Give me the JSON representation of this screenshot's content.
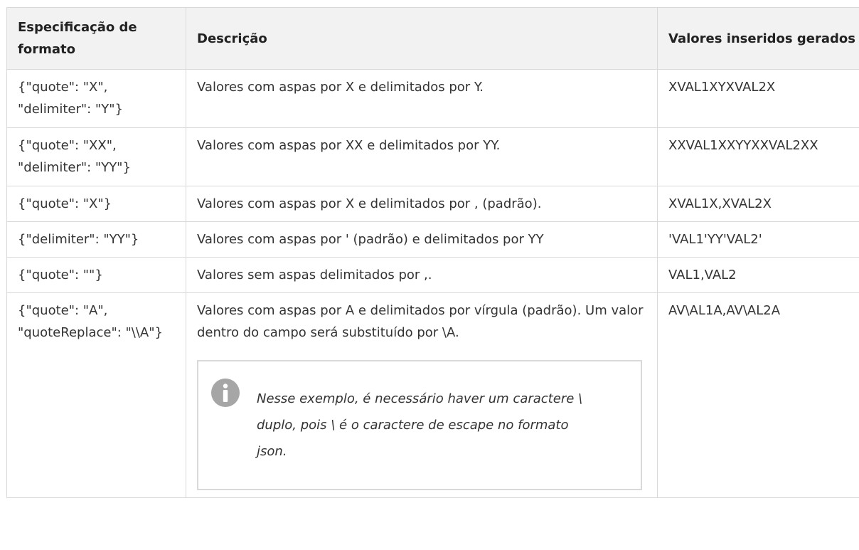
{
  "table": {
    "headers": [
      "Especificação de formato",
      "Descrição",
      "Valores inseridos gerados"
    ],
    "rows": [
      {
        "spec": "{\"quote\": \"X\", \"delimiter\": \"Y\"}",
        "desc": "Valores com aspas por X e delimitados por Y.",
        "value": "XVAL1XYXVAL2X"
      },
      {
        "spec": "{\"quote\": \"XX\", \"delimiter\": \"YY\"}",
        "desc": "Valores com aspas por XX e delimitados por YY.",
        "value": "XXVAL1XXYYXXVAL2XX"
      },
      {
        "spec": "{\"quote\": \"X\"}",
        "desc": "Valores com aspas por X e delimitados por , (padrão).",
        "value": "XVAL1X,XVAL2X"
      },
      {
        "spec": "{\"delimiter\": \"YY\"}",
        "desc": "Valores com aspas por ' (padrão) e delimitados por YY",
        "value": "'VAL1'YY'VAL2'"
      },
      {
        "spec": "{\"quote\": \"\"}",
        "desc": "Valores sem aspas delimitados por ,.",
        "value": "VAL1,VAL2"
      },
      {
        "spec": "{\"quote\": \"A\", \"quoteReplace\": \"\\\\A\"}",
        "desc": "Valores com aspas por A e delimitados por vírgula (padrão). Um valor dentro do campo será substituído por \\A.",
        "value": "AV\\AL1A,AV\\AL2A"
      }
    ],
    "note": {
      "icon": "info-icon",
      "icon_color": "#a6a6a6",
      "text": "Nesse exemplo, é necessário haver um caractere \\ duplo, pois \\ é o caractere de escape no formato json."
    }
  }
}
